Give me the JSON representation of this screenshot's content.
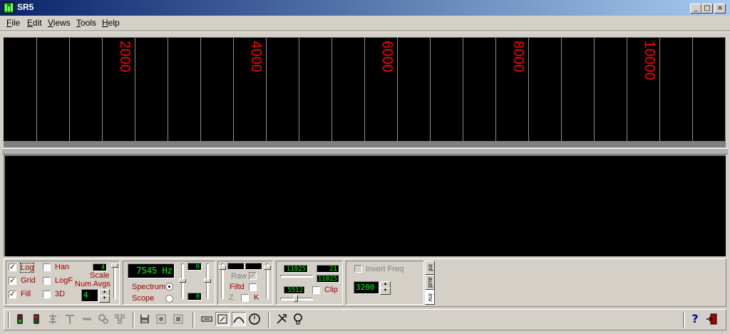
{
  "window": {
    "title": "SR5",
    "minimize": "_",
    "maximize": "□",
    "close": "×"
  },
  "menu": [
    "File",
    "Edit",
    "Views",
    "Tools",
    "Help"
  ],
  "spectrum": {
    "freq_labels": [
      "2000",
      "4000",
      "6000",
      "8000",
      "10000"
    ]
  },
  "checks": {
    "log": {
      "label": "Log",
      "checked": true
    },
    "grid": {
      "label": "Grid",
      "checked": true
    },
    "fill": {
      "label": "Fill",
      "checked": true
    },
    "han": {
      "label": "Han",
      "checked": false
    },
    "logf": {
      "label": "LogF",
      "checked": false
    },
    "threed": {
      "label": "3D",
      "checked": false
    }
  },
  "scale": {
    "label": "Scale",
    "value": "4"
  },
  "num_avgs": {
    "label": "Num Avgs",
    "value": "4"
  },
  "frequency": {
    "display": "7545 Hz"
  },
  "mode": {
    "spectrum_label": "Spectrum",
    "scope_label": "Scope",
    "selected": "spectrum"
  },
  "level_displays": {
    "top": "0",
    "bottom": "0"
  },
  "filter": {
    "raw_label": "Raw",
    "filtd_label": "Filtd",
    "z_label": "Z",
    "k_label": "K"
  },
  "sample": {
    "rate_top": "11025",
    "value_small": "21",
    "rate_mid": "11025",
    "rate_low": "5512",
    "clip_label": "Clip"
  },
  "invert": {
    "label": "Invert Freq",
    "value": "3200"
  },
  "tabs": [
    "inf",
    "aud",
    "inv"
  ],
  "toolbar_icons": [
    "traffic-light-green-icon",
    "traffic-light-red-icon",
    "align-icon",
    "text-tool-icon",
    "dash-icon",
    "gears-icon",
    "network-icon",
    "save-icon",
    "record-icon",
    "stop-icon",
    "link-icon",
    "zoom-box-icon",
    "curve-icon",
    "clock-icon",
    "tools-icon",
    "bulb-icon",
    "help-icon",
    "exit-icon"
  ]
}
